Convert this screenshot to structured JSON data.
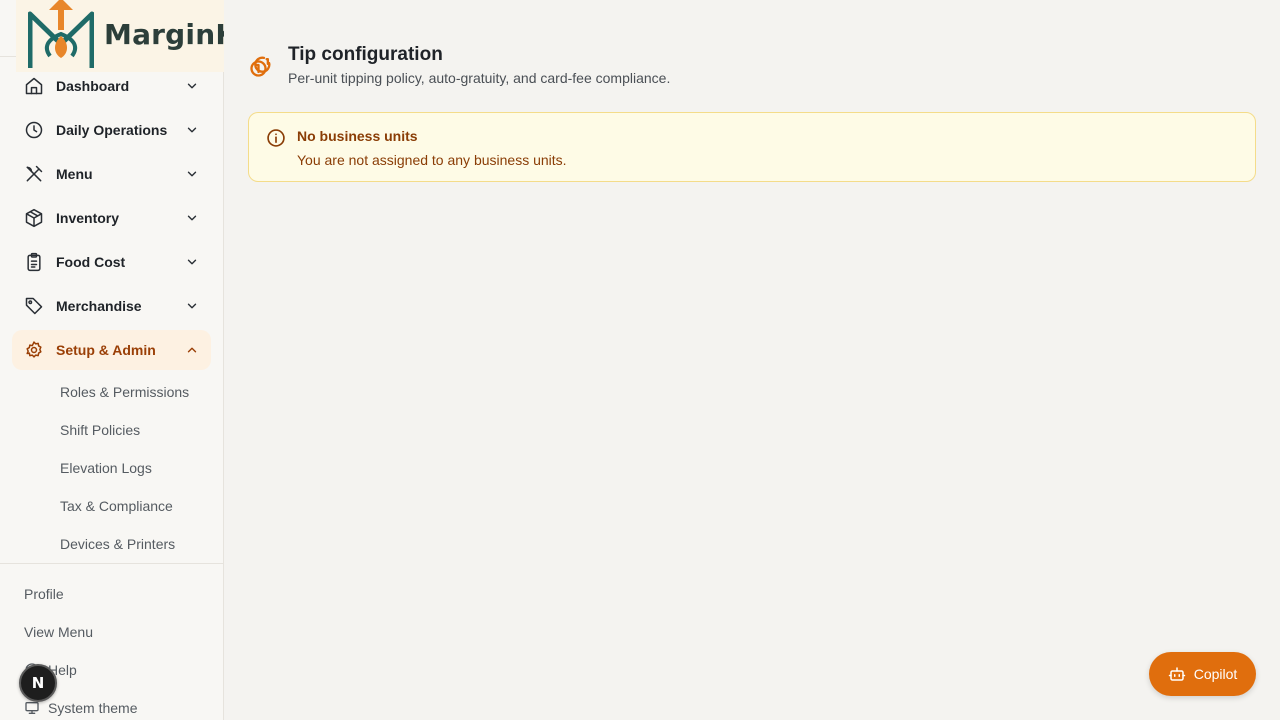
{
  "brand": {
    "name": "MarginK",
    "colors": {
      "accent": "#e06e0d",
      "brand_dark": "#1f6b68",
      "active_bg": "#fdf1e2"
    }
  },
  "sidebar": {
    "items": [
      {
        "label": "Dashboard",
        "icon": "home-icon",
        "expanded": false
      },
      {
        "label": "Daily Operations",
        "icon": "clock-icon",
        "expanded": false
      },
      {
        "label": "Menu",
        "icon": "utensils-icon",
        "expanded": false
      },
      {
        "label": "Inventory",
        "icon": "box-icon",
        "expanded": false
      },
      {
        "label": "Food Cost",
        "icon": "clipboard-icon",
        "expanded": false
      },
      {
        "label": "Merchandise",
        "icon": "tag-icon",
        "expanded": false
      },
      {
        "label": "Setup & Admin",
        "icon": "gear-icon",
        "expanded": true
      }
    ],
    "sub_items": [
      "Roles & Permissions",
      "Shift Policies",
      "Elevation Logs",
      "Tax & Compliance",
      "Devices & Printers"
    ],
    "bottom": {
      "profile": "Profile",
      "view_menu": "View Menu",
      "help": "Help",
      "theme": "System theme"
    },
    "user_initial": "N"
  },
  "page": {
    "title": "Tip configuration",
    "subtitle": "Per-unit tipping policy, auto-gratuity, and card-fee compliance."
  },
  "alert": {
    "title": "No business units",
    "message": "You are not assigned to any business units."
  },
  "copilot": {
    "label": "Copilot"
  }
}
